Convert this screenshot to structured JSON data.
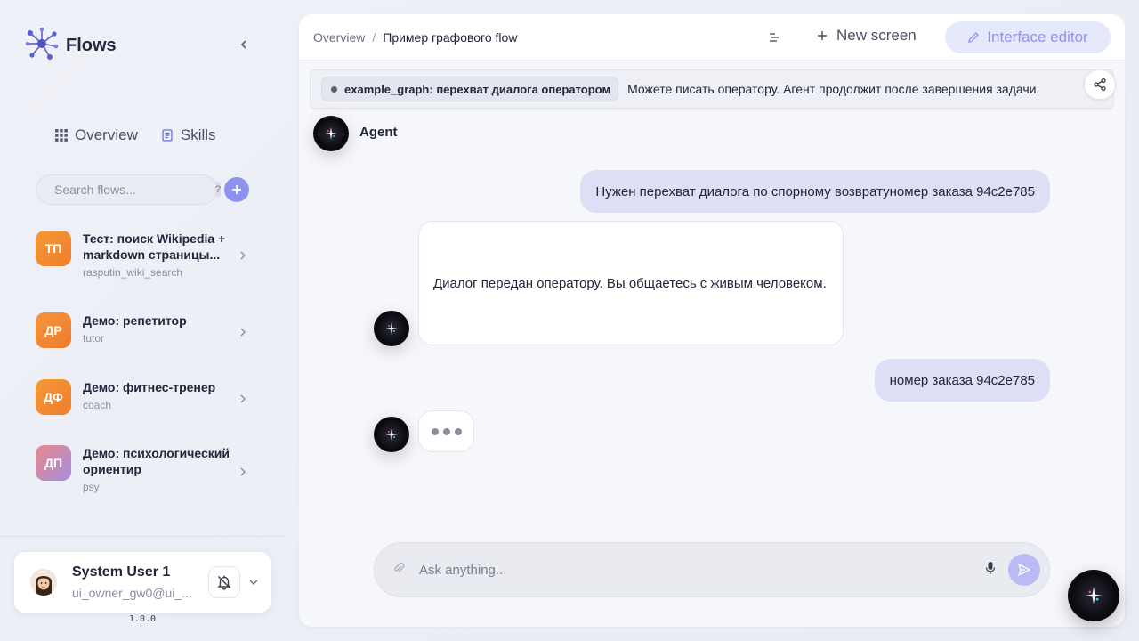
{
  "app": {
    "name": "Flows",
    "version": "1.0.0"
  },
  "nav": {
    "overview": "Overview",
    "skills": "Skills"
  },
  "search": {
    "placeholder": "Search flows...",
    "help": "?"
  },
  "flows": [
    {
      "initials": "ТП",
      "title": "Тест: поиск Wikipedia + markdown страницы...",
      "slug": "rasputin_wiki_search",
      "color": "#f08a2a"
    },
    {
      "initials": "ДР",
      "title": "Демо: репетитор",
      "slug": "tutor",
      "color": "#f0822e"
    },
    {
      "initials": "ДФ",
      "title": "Демо: фитнес-тренер",
      "slug": "coach",
      "color": "#f08a2a"
    },
    {
      "initials": "ДП",
      "title": "Демо: психологический ориентир",
      "slug": "psy",
      "color": "#c47fb8"
    }
  ],
  "user": {
    "name": "System User 1",
    "email": "ui_owner_gw0@ui_..."
  },
  "breadcrumb": {
    "root": "Overview",
    "separator": "/",
    "current": "Пример графового flow"
  },
  "toolbar": {
    "new_screen": "New screen",
    "interface_editor": "Interface editor"
  },
  "status": {
    "tag": "example_graph: перехват диалога оператором",
    "message": "Можете писать оператору. Агент продолжит после завершения задачи."
  },
  "chat": {
    "agent_name": "Agent",
    "messages": [
      {
        "role": "user",
        "text": "Нужен перехват диалога по спорному возвратуномер заказа 94c2e785"
      },
      {
        "role": "agent",
        "text": "Диалог передан оператору. Вы общаетесь с живым человеком."
      },
      {
        "role": "user",
        "text": "номер заказа 94c2e785"
      }
    ],
    "composer_placeholder": "Ask anything..."
  },
  "colors": {
    "accent": "#8d92ee",
    "user_bubble": "#dddff7"
  }
}
